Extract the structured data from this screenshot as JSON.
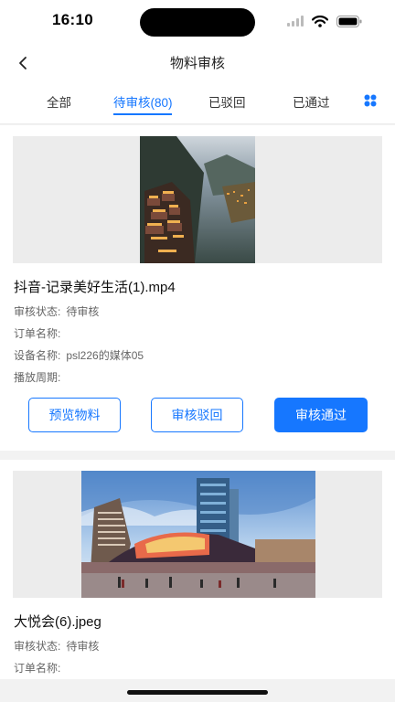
{
  "status_bar": {
    "time": "16:10"
  },
  "header": {
    "title": "物料审核"
  },
  "tabs": [
    {
      "label": "全部",
      "active": false
    },
    {
      "label": "待审核(80)",
      "active": true
    },
    {
      "label": "已驳回",
      "active": false
    },
    {
      "label": "已通过",
      "active": false
    }
  ],
  "colors": {
    "accent": "#1677ff",
    "background": "#f2f2f2"
  },
  "items": [
    {
      "name": "抖音-记录美好生活(1).mp4",
      "status_label": "审核状态:",
      "status_value": "待审核",
      "order_label": "订单名称:",
      "order_value": "",
      "device_label": "设备名称:",
      "device_value": "psl226的媒体05",
      "period_label": "播放周期:",
      "period_value": "",
      "actions": {
        "preview": "预览物料",
        "reject": "审核驳回",
        "approve": "审核通过"
      }
    },
    {
      "name": "大悦会(6).jpeg",
      "status_label": "审核状态:",
      "status_value": "待审核",
      "order_label": "订单名称:",
      "order_value": ""
    }
  ]
}
